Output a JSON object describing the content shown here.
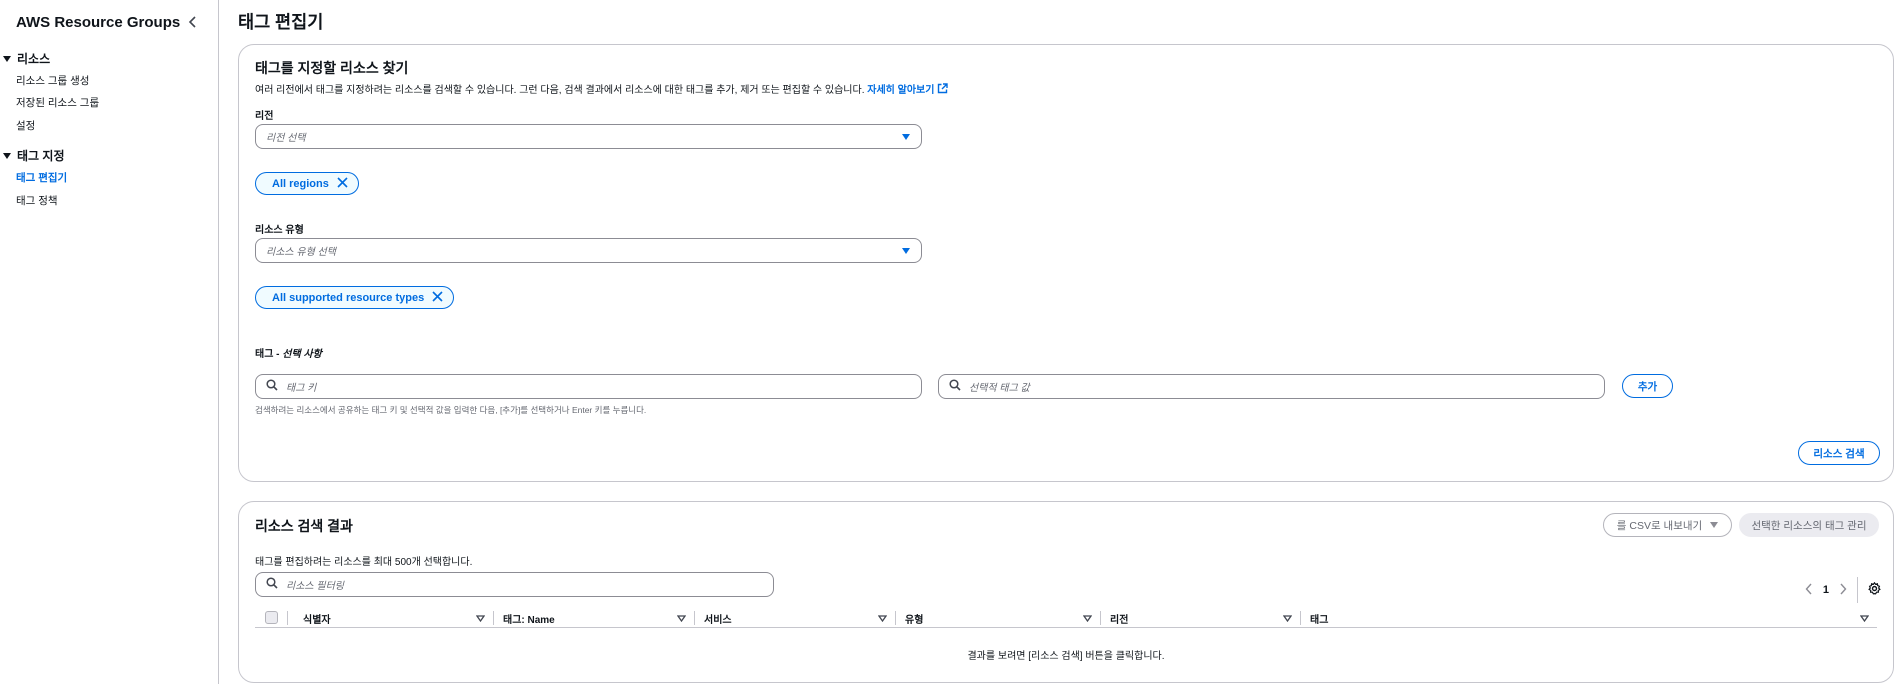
{
  "sidebar": {
    "title": "AWS Resource Groups",
    "sections": [
      {
        "label": "리소스",
        "items": [
          "리소스 그룹 생성",
          "저장된 리소스 그룹",
          "설정"
        ]
      },
      {
        "label": "태그 지정",
        "items": [
          "태그 편집기",
          "태그 정책"
        ]
      }
    ],
    "active_item": "태그 편집기"
  },
  "page": {
    "title": "태그 편집기"
  },
  "find": {
    "title": "태그를 지정할 리소스 찾기",
    "description": "여러 리전에서 태그를 지정하려는 리소스를 검색할 수 있습니다. 그런 다음, 검색 결과에서 리소스에 대한 태그를 추가, 제거 또는 편집할 수 있습니다.",
    "learn_more": "자세히 알아보기",
    "region_label": "리전",
    "region_placeholder": "리전 선택",
    "region_token": "All regions",
    "type_label": "리소스 유형",
    "type_placeholder": "리소스 유형 선택",
    "type_token": "All supported resource types",
    "tags_label": "태그 - ",
    "tags_optional": "선택 사항",
    "tag_key_placeholder": "태그 키",
    "tag_value_placeholder": "선택적 태그 값",
    "add_button": "추가",
    "hint": "검색하려는 리소스에서 공유하는 태그 키 및 선택적 값을 입력한 다음, [추가]를 선택하거나 Enter 키를 누릅니다.",
    "search_button": "리소스 검색"
  },
  "results": {
    "title": "리소스 검색 결과",
    "export_button": "를 CSV로 내보내기",
    "manage_button": "선택한 리소스의 태그 관리",
    "description": "태그를 편집하려는 리소스를 최대 500개 선택합니다.",
    "filter_placeholder": "리소스 필터링",
    "page_number": "1",
    "columns": [
      "식별자",
      "태그: Name",
      "서비스",
      "유형",
      "리전",
      "태그"
    ],
    "empty_text": "결과를 보려면 [리소스 검색] 버튼을 클릭합니다."
  },
  "colors": {
    "accent": "#006ce0",
    "border": "#c6c6cd",
    "text": "#0f141a"
  },
  "icons": [
    "chevron-left-icon",
    "caret-down-icon",
    "close-icon",
    "external-link-icon",
    "search-icon",
    "sort-icon",
    "settings-icon",
    "chevron-right-icon"
  ]
}
